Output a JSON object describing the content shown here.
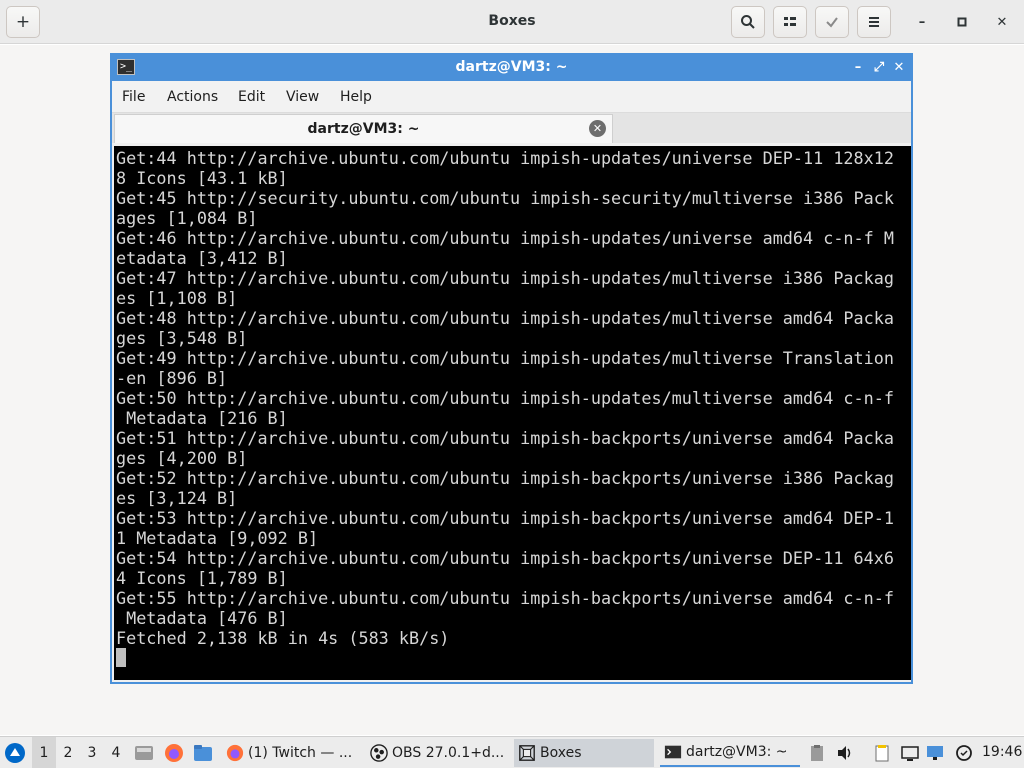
{
  "boxes": {
    "title": "Boxes",
    "add_label": "+",
    "search_glyph": "⚲",
    "view_glyph": "▦",
    "select_glyph": "✔",
    "menu_glyph": "☰",
    "minimize_glyph": "–",
    "maximize_glyph": "▫",
    "close_glyph": "✕"
  },
  "vm": {
    "title": "dartz@VM3: ~",
    "title_icon": ">_",
    "controls": {
      "minimize": "–",
      "restore": "⤢",
      "close": "✕"
    },
    "menu": [
      "File",
      "Actions",
      "Edit",
      "View",
      "Help"
    ],
    "tab_label": "dartz@VM3: ~",
    "tab_close": "✕"
  },
  "terminal": {
    "lines": [
      "Get:44 http://archive.ubuntu.com/ubuntu impish-updates/universe DEP-11 128x12",
      "8 Icons [43.1 kB]",
      "Get:45 http://security.ubuntu.com/ubuntu impish-security/multiverse i386 Pack",
      "ages [1,084 B]",
      "Get:46 http://archive.ubuntu.com/ubuntu impish-updates/universe amd64 c-n-f M",
      "etadata [3,412 B]",
      "Get:47 http://archive.ubuntu.com/ubuntu impish-updates/multiverse i386 Packag",
      "es [1,108 B]",
      "Get:48 http://archive.ubuntu.com/ubuntu impish-updates/multiverse amd64 Packa",
      "ges [3,548 B]",
      "Get:49 http://archive.ubuntu.com/ubuntu impish-updates/multiverse Translation",
      "-en [896 B]",
      "Get:50 http://archive.ubuntu.com/ubuntu impish-updates/multiverse amd64 c-n-f",
      " Metadata [216 B]",
      "Get:51 http://archive.ubuntu.com/ubuntu impish-backports/universe amd64 Packa",
      "ges [4,200 B]",
      "Get:52 http://archive.ubuntu.com/ubuntu impish-backports/universe i386 Packag",
      "es [3,124 B]",
      "Get:53 http://archive.ubuntu.com/ubuntu impish-backports/universe amd64 DEP-1",
      "1 Metadata [9,092 B]",
      "Get:54 http://archive.ubuntu.com/ubuntu impish-backports/universe DEP-11 64x6",
      "4 Icons [1,789 B]",
      "Get:55 http://archive.ubuntu.com/ubuntu impish-backports/universe amd64 c-n-f",
      " Metadata [476 B]",
      "Fetched 2,138 kB in 4s (583 kB/s)"
    ]
  },
  "taskbar": {
    "workspaces": [
      "1",
      "2",
      "3",
      "4"
    ],
    "tasks": {
      "twitch": "(1) Twitch — ...",
      "obs": "OBS 27.0.1+d...",
      "boxes": "Boxes",
      "terminal": "dartz@VM3: ~"
    },
    "clock": "19:46",
    "colors": {
      "accent": "#4a90d9",
      "firefox": "#ff7139",
      "files": "#4a90d9"
    }
  }
}
